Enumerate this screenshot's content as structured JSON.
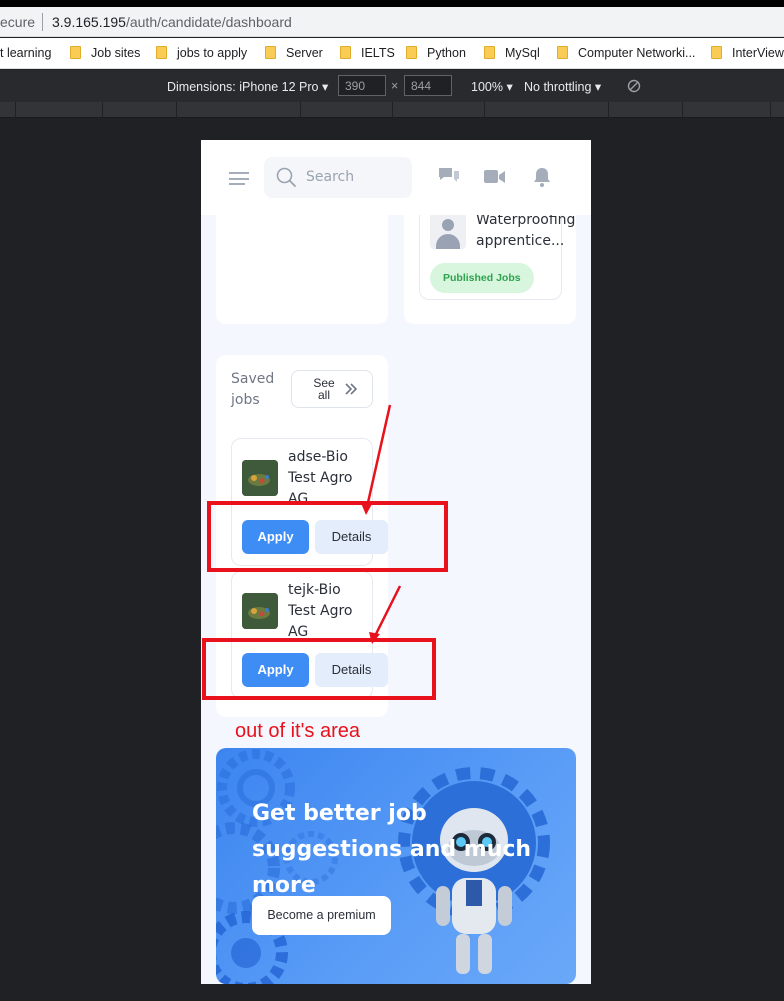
{
  "browser": {
    "security_label": "ecure",
    "url_host": "3.9.165.195",
    "url_path": "/auth/candidate/dashboard",
    "bookmarks": [
      {
        "label": "t learning"
      },
      {
        "label": "Job sites"
      },
      {
        "label": "jobs to apply"
      },
      {
        "label": "Server"
      },
      {
        "label": "IELTS"
      },
      {
        "label": "Python"
      },
      {
        "label": "MySql"
      },
      {
        "label": "Computer Networki..."
      },
      {
        "label": "InterView"
      }
    ]
  },
  "devtools": {
    "device_label": "Dimensions: iPhone 12 Pro",
    "width": "390",
    "height": "844",
    "times": "×",
    "zoom": "100%",
    "throttling": "No throttling"
  },
  "header": {
    "search_placeholder": "Search"
  },
  "published_job": {
    "title": "Waterproofing apprentice...",
    "badge": "Published Jobs"
  },
  "saved_jobs": {
    "title": "Saved jobs",
    "see_all": "See all",
    "items": [
      {
        "title": "adse-Bio Test Agro AG",
        "apply": "Apply",
        "details": "Details"
      },
      {
        "title": "tejk-Bio Test Agro AG",
        "apply": "Apply",
        "details": "Details"
      }
    ]
  },
  "promo": {
    "headline": "Get better job suggestions and much more",
    "button": "Become a premium"
  },
  "annotation": {
    "text": "out of it's area",
    "color": "#e8111c"
  },
  "colors": {
    "primary": "#3d8df5",
    "success_bg": "#d8f5dd",
    "success_text": "#2ea44f"
  }
}
